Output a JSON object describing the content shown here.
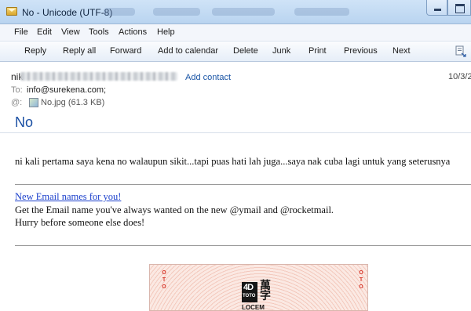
{
  "window": {
    "title": "No - Unicode (UTF-8)"
  },
  "menu": [
    "File",
    "Edit",
    "View",
    "Tools",
    "Actions",
    "Help"
  ],
  "toolbar": {
    "buttons": [
      "Reply",
      "Reply all",
      "Forward",
      "Add to calendar",
      "Delete",
      "Junk",
      "Print",
      "Previous",
      "Next"
    ],
    "icon": "expand-message-icon"
  },
  "header": {
    "sender_visible": "nik",
    "add_contact": "Add contact",
    "date": "10/3/2",
    "to_label": "To:",
    "to_value": "info@surekena.com;",
    "attachment": "No.jpg (61.3 KB)",
    "subject": "No"
  },
  "body": {
    "message": "ni kali pertama saya kena no walaupun sikit...tapi puas hati lah juga...saya nak cuba lagi untuk yang seterusnya",
    "promo_link": "New Email names for you!",
    "promo_line1": "Get the Email name you've always wanted on the new @ymail and @rocketmail.",
    "promo_line2": "Hurry before someone else does!"
  },
  "ticket": {
    "logo": "4D",
    "brand": "TOTO",
    "han": "萬字",
    "side_left": "OTO",
    "side_right": "OTO",
    "code": "LOCEM"
  },
  "colors": {
    "link": "#1a3fcc",
    "subject": "#1a4fa3",
    "add_contact": "#1a55a6"
  }
}
